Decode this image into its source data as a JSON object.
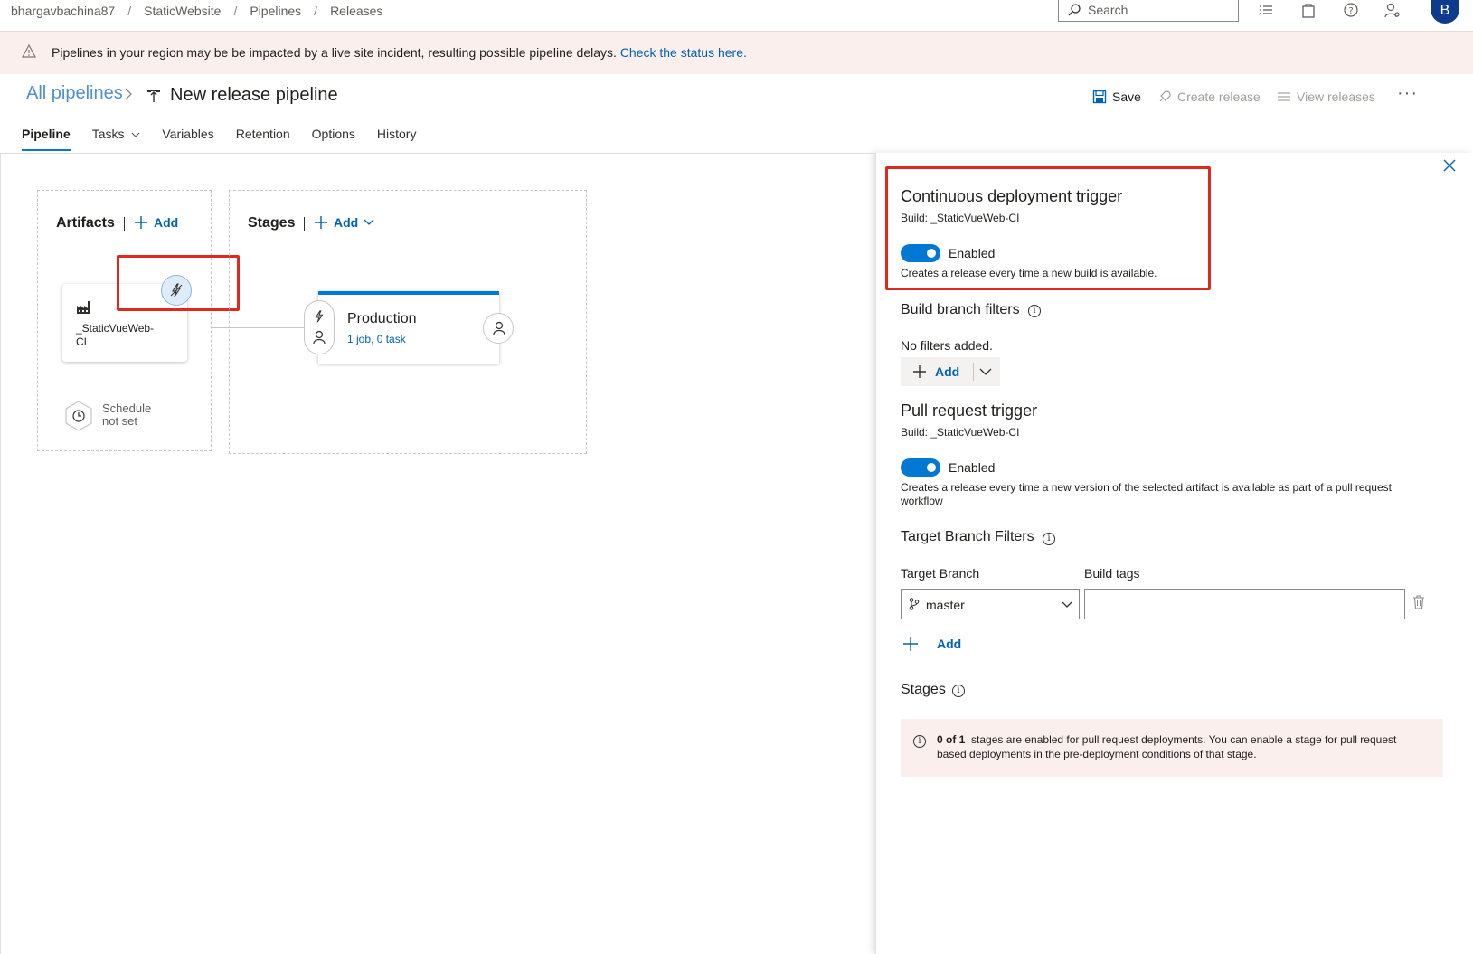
{
  "breadcrumb": [
    "bhargavbachina87",
    "StaticWebsite",
    "Pipelines",
    "Releases"
  ],
  "search": {
    "placeholder": "Search"
  },
  "user": {
    "initial": "B"
  },
  "banner": {
    "text": "Pipelines in your region may be be impacted by a live site incident, resulting possible pipeline delays.",
    "link": "Check the status here."
  },
  "header": {
    "all_pipelines": "All pipelines",
    "title": "New release pipeline",
    "save": "Save",
    "create_release": "Create release",
    "view_releases": "View releases",
    "more": "···"
  },
  "tabs": [
    "Pipeline",
    "Tasks",
    "Variables",
    "Retention",
    "Options",
    "History"
  ],
  "canvas": {
    "artifacts_title": "Artifacts",
    "artifacts_add": "Add",
    "artifact_name_1": "_StaticVueWeb-",
    "artifact_name_2": "CI",
    "schedule_1": "Schedule",
    "schedule_2": "not set",
    "stages_title": "Stages",
    "stages_add": "Add",
    "stage_name": "Production",
    "stage_sub": "1 job, 0 task"
  },
  "panel": {
    "cd_title": "Continuous deployment trigger",
    "cd_build": "Build: _StaticVueWeb-CI",
    "cd_enabled": "Enabled",
    "cd_desc": "Creates a release every time a new build is available.",
    "bbf_title": "Build branch filters",
    "bbf_none": "No filters added.",
    "bbf_add": "Add",
    "pr_title": "Pull request trigger",
    "pr_build": "Build: _StaticVueWeb-CI",
    "pr_enabled": "Enabled",
    "pr_desc_1": "Creates a release every time a new version of the selected artifact is available as part of a pull request",
    "pr_desc_2": "workflow",
    "tbf_title": "Target Branch Filters",
    "target_branch_label": "Target Branch",
    "build_tags_label": "Build tags",
    "target_branch_value": "master",
    "tbf_add": "Add",
    "stages_title": "Stages",
    "stages_count": "0 of 1",
    "stages_notice_1": "stages are enabled for pull request deployments. You can enable a stage for pull request",
    "stages_notice_2": "based deployments in the pre-deployment conditions of that stage."
  },
  "colors": {
    "accent": "#0078d4",
    "highlight": "#e0281e",
    "banner": "#fbefee"
  }
}
